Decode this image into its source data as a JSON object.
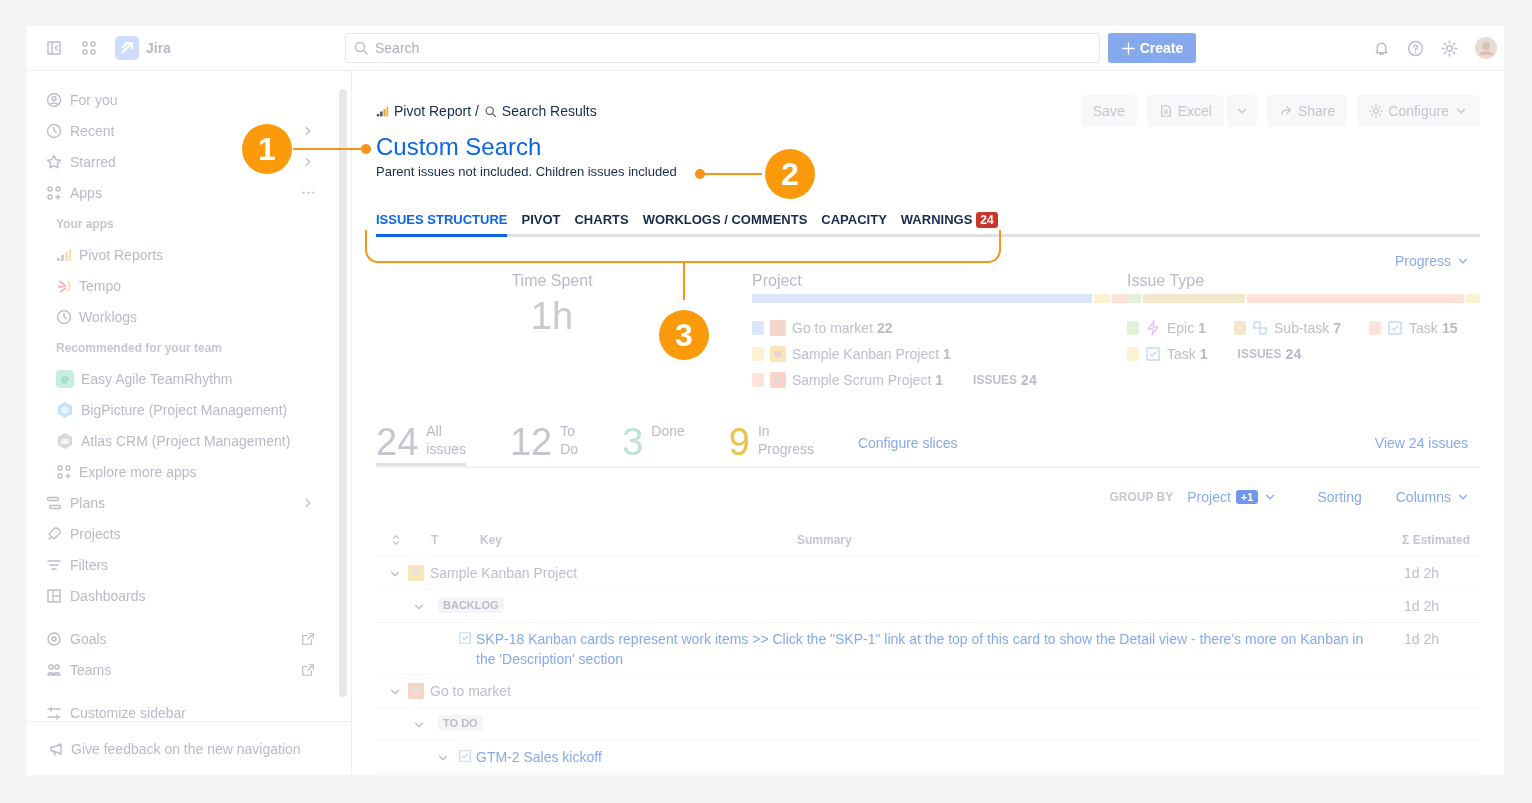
{
  "topbar": {
    "app_name": "Jira",
    "search": {
      "placeholder": "Search"
    },
    "create_label": "Create"
  },
  "sidebar": {
    "items": [
      {
        "label": "For you",
        "kind": "nav"
      },
      {
        "label": "Recent",
        "kind": "nav"
      },
      {
        "label": "Starred",
        "kind": "nav"
      },
      {
        "label": "Apps",
        "kind": "nav"
      },
      {
        "label": "Your apps",
        "kind": "heading"
      },
      {
        "label": "Pivot Reports",
        "kind": "app"
      },
      {
        "label": "Tempo",
        "kind": "app"
      },
      {
        "label": "Worklogs",
        "kind": "app"
      },
      {
        "label": "Recommended for your team",
        "kind": "heading"
      },
      {
        "label": "Easy Agile TeamRhythm",
        "kind": "app"
      },
      {
        "label": "BigPicture (Project Management)",
        "kind": "app"
      },
      {
        "label": "Atlas CRM (Project Management)",
        "kind": "app"
      },
      {
        "label": "Explore more apps",
        "kind": "app"
      },
      {
        "label": "Plans",
        "kind": "nav"
      },
      {
        "label": "Projects",
        "kind": "nav"
      },
      {
        "label": "Filters",
        "kind": "nav"
      },
      {
        "label": "Dashboards",
        "kind": "nav"
      },
      {
        "label": "Goals",
        "kind": "nav"
      },
      {
        "label": "Teams",
        "kind": "nav"
      },
      {
        "label": "Customize sidebar",
        "kind": "nav"
      }
    ],
    "feedback": "Give feedback on the new navigation"
  },
  "header": {
    "breadcrumb": [
      "Pivot Report /",
      "Search Results"
    ],
    "actions": {
      "save": "Save",
      "excel": "Excel",
      "share": "Share",
      "configure": "Configure"
    },
    "title": "Custom Search",
    "subtitle": "Parent issues not included. Children issues included"
  },
  "tabs": [
    {
      "label": "ISSUES STRUCTURE",
      "selected": true
    },
    {
      "label": "PIVOT",
      "selected": false
    },
    {
      "label": "CHARTS",
      "selected": false
    },
    {
      "label": "WORKLOGS / COMMENTS",
      "selected": false
    },
    {
      "label": "CAPACITY",
      "selected": false
    },
    {
      "label": "WARNINGS",
      "selected": false,
      "badge": "24"
    }
  ],
  "summary": {
    "progress": "Progress",
    "time_spent": {
      "label": "Time Spent",
      "value": "1h"
    },
    "breakdowns": [
      {
        "title": "Project",
        "total_label": "ISSUES",
        "total": "24",
        "items": [
          {
            "name": "Go to market",
            "count": "22",
            "color": "#dbe6fb"
          },
          {
            "name": "Sample Kanban Project",
            "count": "1",
            "color": "#fdf1d3"
          },
          {
            "name": "Sample Scrum Project",
            "count": "1",
            "color": "#fde3d9"
          }
        ]
      },
      {
        "title": "Issue Type",
        "total_label": "ISSUES",
        "total": "24",
        "items": [
          {
            "name": "Epic",
            "count": "1",
            "color": "#e3f0da"
          },
          {
            "name": "Sub-task",
            "count": "7",
            "color": "#f2e7cb"
          },
          {
            "name": "Task",
            "count": "15",
            "color": "#fde3d9"
          },
          {
            "name": "Task",
            "count": "1",
            "color": "#fdf1d3"
          }
        ]
      }
    ]
  },
  "stats": {
    "items": [
      {
        "value": "24",
        "label": "All issues",
        "selected": true,
        "color": "#c3c8d0"
      },
      {
        "value": "12",
        "label": "To Do",
        "selected": false,
        "color": "#c3c8d0"
      },
      {
        "value": "3",
        "label": "Done",
        "selected": false,
        "color": "#bfe2d4"
      },
      {
        "value": "9",
        "label": "In Progress",
        "selected": false,
        "color": "#e9c350"
      }
    ],
    "configure_slices": "Configure slices",
    "view_all": "View 24 issues"
  },
  "toolbar": {
    "group_by_label": "GROUP BY",
    "group_by": "Project",
    "extra": "+1",
    "sorting": "Sorting",
    "columns": "Columns"
  },
  "table": {
    "columns": [
      "T",
      "Key",
      "Summary",
      "Σ Estimated"
    ],
    "rows": [
      {
        "kind": "project",
        "label": "Sample Kanban Project",
        "color": "#fbe7b5",
        "estimate": "1d 2h",
        "expanded": true,
        "children": [
          {
            "kind": "status",
            "label": "BACKLOG",
            "estimate": "1d 2h",
            "expanded": true,
            "children": [
              {
                "kind": "issue",
                "label": "SKP-18 Kanban cards represent work items >> Click the \"SKP-1\" link at the top of this card to show the Detail view - there's more on Kanban in the 'Description' section",
                "estimate": "1d 2h"
              }
            ]
          }
        ]
      },
      {
        "kind": "project",
        "label": "Go to market",
        "color": "#f9d3c8",
        "expanded": true,
        "children": [
          {
            "kind": "status",
            "label": "TO DO",
            "expanded": true,
            "children": [
              {
                "kind": "issue",
                "label": "GTM-2 Sales kickoff",
                "expanded": true
              }
            ]
          }
        ]
      }
    ]
  },
  "callouts": [
    {
      "number": "1"
    },
    {
      "number": "2"
    },
    {
      "number": "3"
    }
  ]
}
